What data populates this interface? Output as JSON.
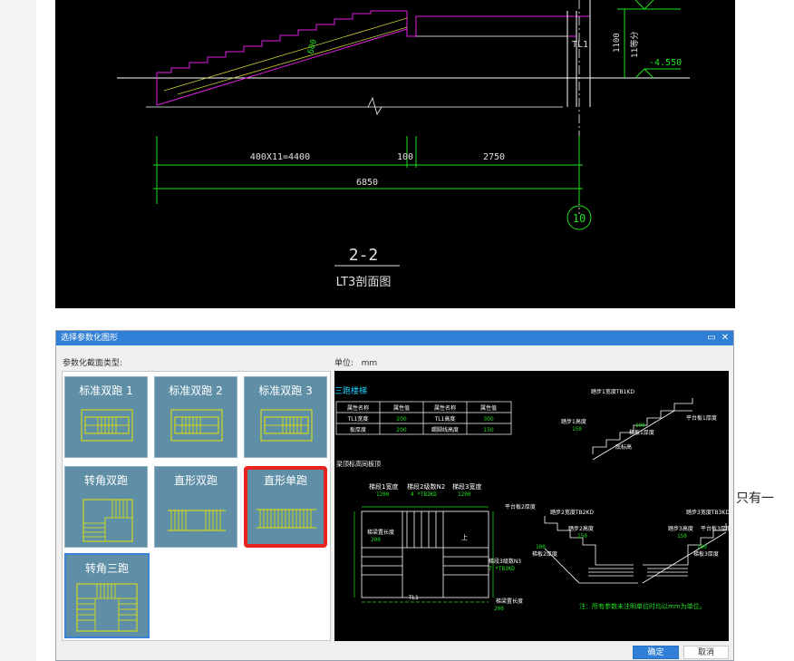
{
  "cad_drawing": {
    "level_label": "-4.550",
    "dim_1100": "1100",
    "dim_11_steps": "11等分",
    "dim_600": "600",
    "tl_label": "TL1",
    "dim_run": "400X11=4400",
    "dim_100": "100",
    "dim_landing": "2750",
    "dim_total": "6850",
    "axis_label": "10",
    "section_title": "2-2",
    "section_subtitle": "LT3剖面图"
  },
  "side_text": "只有一",
  "dialog": {
    "title": "选择参数化图形",
    "section_type_label": "参数化截面类型:",
    "unit_label": "单位:",
    "unit_value": "mm",
    "tiles": [
      {
        "label": "标准双跑 1"
      },
      {
        "label": "标准双跑 2"
      },
      {
        "label": "标准双跑 3"
      },
      {
        "label": "转角双跑"
      },
      {
        "label": "直形双跑"
      },
      {
        "label": "直形单跑"
      },
      {
        "label": "转角三跑"
      }
    ],
    "ok_button": "确定",
    "cancel_button": "取消",
    "maximize_icon": "maximize-icon",
    "close_icon": "close-icon"
  },
  "preview": {
    "title": "三跑楼梯",
    "table_headers": [
      "属性名称",
      "属性值",
      "属性名称",
      "属性值"
    ],
    "table_rows": [
      [
        "TL1宽度",
        "200",
        "TL1高度",
        "300"
      ],
      [
        "板厚度",
        "200",
        "踢脚线高度",
        "150"
      ]
    ],
    "subtitle": "梁顶标高同板顶",
    "step1_width_label": "梯段1宽度",
    "step1_width_val": "1200",
    "step2_count_label": "梯段2级数N2",
    "step2_count_val": "4 *TB2KD",
    "step3_width_label": "梯段3宽度",
    "step3_width_val": "1200",
    "left_length_label": "梯梁置长度",
    "left_length_val": "200",
    "right_length_label": "梯梁置长度",
    "right_length_val": "200",
    "step3_count_label": "梯段3级数N3",
    "step3_count_val": "7 *TB3KD",
    "tl_label": "TL1",
    "up_label": "上",
    "tr_tread_label": "踏步1宽度TB1KD",
    "tr_height_label": "踏步1高度",
    "tr_height_val": "150",
    "tr_slab_label": "梯板1厚度",
    "tr_slab_val": "100",
    "tr_landing_label": "平台板1厚度",
    "tr_beam_label": "底标高",
    "bl_landing_label": "平台板2厚度",
    "bl_tread_label": "踏步2宽度TB2KD",
    "bl_height_label": "踏步2高度",
    "bl_height_val": "150",
    "bl_slab_label": "梯板2厚度",
    "bl_slab_val": "100",
    "br_tread_label": "踏步3宽度TB3KD",
    "br_landing_label": "平台板3厚度",
    "br_height_label": "踏步3高度",
    "br_height_val": "150",
    "br_slab_label": "梯板3厚度",
    "br_slab_val": "100",
    "note": "注：所有参数未注明单位时均以mm为单位。"
  },
  "colors": {
    "cad_bg": "#000000",
    "cad_green": "#1fe01f",
    "cad_magenta": "#e01fe0",
    "cad_yellow": "#e6e600",
    "titlebar_blue": "#2f7fd6",
    "tile_bg": "#5f8fa6",
    "selection_red": "#e8231f"
  }
}
